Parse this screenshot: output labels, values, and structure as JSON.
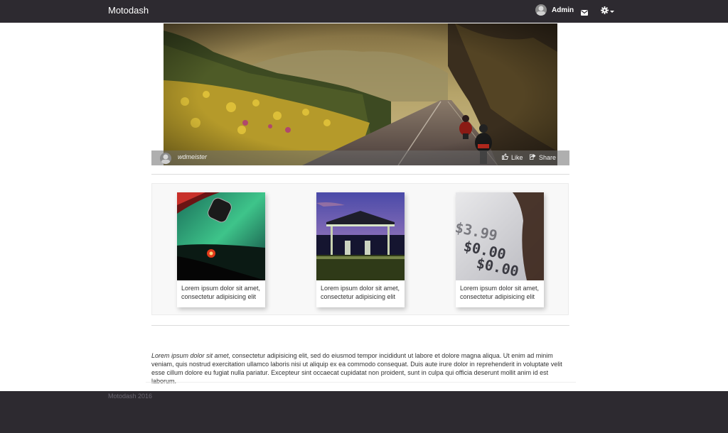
{
  "navbar": {
    "brand": "Motodash",
    "user_label": "Admin",
    "icons": {
      "avatar": "avatar",
      "mail": "envelope-icon",
      "settings": "gear-icon",
      "caret": "caret-down-icon"
    }
  },
  "hero": {
    "author": "wdmeister",
    "like_label": "Like",
    "share_label": "Share",
    "icons": {
      "like": "thumbs-up-icon",
      "share": "share-icon"
    }
  },
  "cards": [
    {
      "caption": "Lorem ipsum dolor sit amet, consectetur adipisicing elit"
    },
    {
      "caption": "Lorem ipsum dolor sit amet, consectetur adipisicing elit"
    },
    {
      "caption": "Lorem ipsum dolor sit amet, consectetur adipisicing elit"
    }
  ],
  "paragraph": {
    "lead": "Lorem ipsum dolor sit amet,",
    "body": " consectetur adipisicing elit, sed do eiusmod tempor incididunt ut labore et dolore magna aliqua. Ut enim ad minim veniam, quis nostrud exercitation ullamco laboris nisi ut aliquip ex ea commodo consequat. Duis aute irure dolor in reprehenderit in voluptate velit esse cillum dolore eu fugiat nulla pariatur. Excepteur sint occaecat cupidatat non proident, sunt in culpa qui officia deserunt mollit anim id est laborum."
  },
  "footer": {
    "copyright": "Motodash 2016"
  },
  "colors": {
    "navbar_bg": "#2d2a30",
    "footer_bg": "#2d2a30",
    "panel_bg": "#f8f8f8"
  }
}
